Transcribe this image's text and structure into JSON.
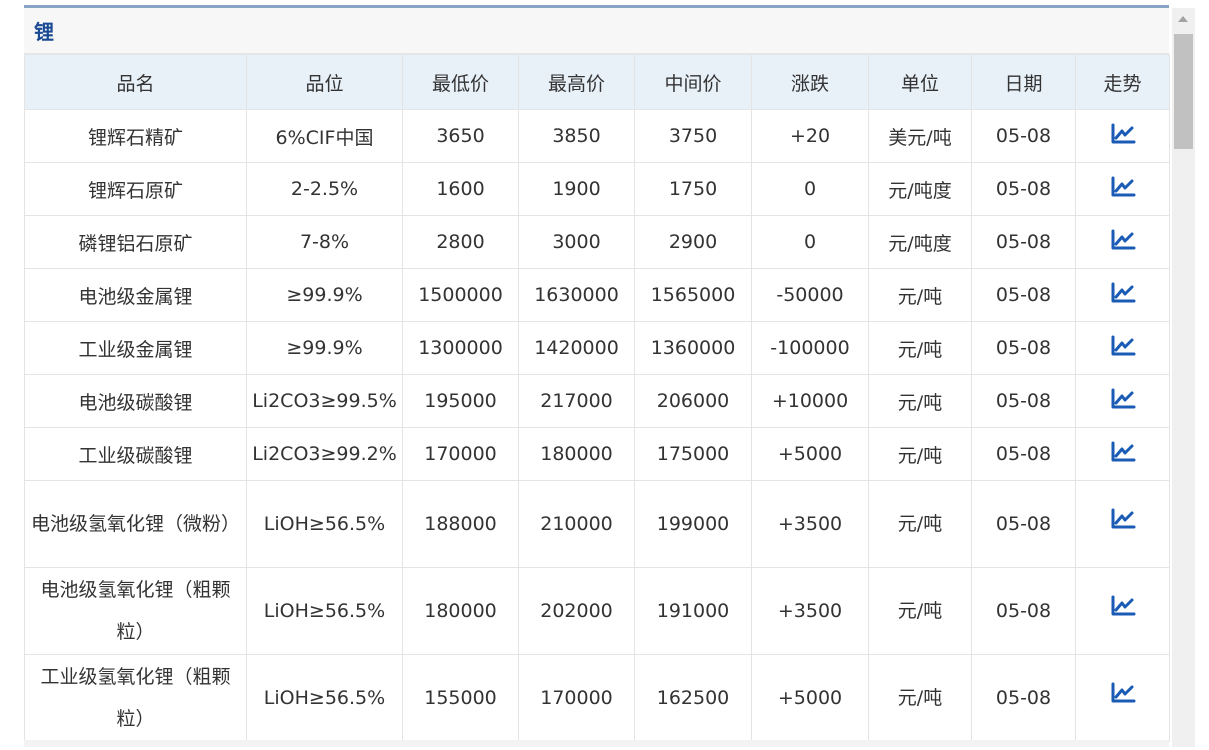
{
  "panel": {
    "title": "锂"
  },
  "table": {
    "headers": [
      "品名",
      "品位",
      "最低价",
      "最高价",
      "中间价",
      "涨跌",
      "单位",
      "日期",
      "走势"
    ],
    "rows": [
      {
        "name": "锂辉石精矿",
        "grade": "6%CIF中国",
        "low": "3650",
        "high": "3850",
        "mid": "3750",
        "change": "+20",
        "unit": "美元/吨",
        "date": "05-08",
        "trend": "up"
      },
      {
        "name": "锂辉石原矿",
        "grade": "2-2.5%",
        "low": "1600",
        "high": "1900",
        "mid": "1750",
        "change": "0",
        "unit": "元/吨度",
        "date": "05-08",
        "trend": "flat"
      },
      {
        "name": "磷锂铝石原矿",
        "grade": "7-8%",
        "low": "2800",
        "high": "3000",
        "mid": "2900",
        "change": "0",
        "unit": "元/吨度",
        "date": "05-08",
        "trend": "flat"
      },
      {
        "name": "电池级金属锂",
        "grade": "≥99.9%",
        "low": "1500000",
        "high": "1630000",
        "mid": "1565000",
        "change": "-50000",
        "unit": "元/吨",
        "date": "05-08",
        "trend": "down"
      },
      {
        "name": "工业级金属锂",
        "grade": "≥99.9%",
        "low": "1300000",
        "high": "1420000",
        "mid": "1360000",
        "change": "-100000",
        "unit": "元/吨",
        "date": "05-08",
        "trend": "down"
      },
      {
        "name": "电池级碳酸锂",
        "grade": "Li2CO3≥99.5%",
        "low": "195000",
        "high": "217000",
        "mid": "206000",
        "change": "+10000",
        "unit": "元/吨",
        "date": "05-08",
        "trend": "up"
      },
      {
        "name": "工业级碳酸锂",
        "grade": "Li2CO3≥99.2%",
        "low": "170000",
        "high": "180000",
        "mid": "175000",
        "change": "+5000",
        "unit": "元/吨",
        "date": "05-08",
        "trend": "up"
      },
      {
        "name": "电池级氢氧化锂（微粉）",
        "grade": "LiOH≥56.5%",
        "low": "188000",
        "high": "210000",
        "mid": "199000",
        "change": "+3500",
        "unit": "元/吨",
        "date": "05-08",
        "trend": "up"
      },
      {
        "name": "电池级氢氧化锂（粗颗粒）",
        "grade": "LiOH≥56.5%",
        "low": "180000",
        "high": "202000",
        "mid": "191000",
        "change": "+3500",
        "unit": "元/吨",
        "date": "05-08",
        "trend": "up"
      },
      {
        "name": "工业级氢氧化锂（粗颗粒）",
        "grade": "LiOH≥56.5%",
        "low": "155000",
        "high": "170000",
        "mid": "162500",
        "change": "+5000",
        "unit": "元/吨",
        "date": "05-08",
        "trend": "up"
      }
    ]
  },
  "icons": {
    "trend": "trend-chart-icon",
    "scroll_up": "scroll-up-arrow-icon"
  },
  "colors": {
    "up": "#e02020",
    "down": "#119911",
    "title": "#1a4a94",
    "header_bg": "#e8f0f8",
    "icon": "#1a5bb5"
  }
}
